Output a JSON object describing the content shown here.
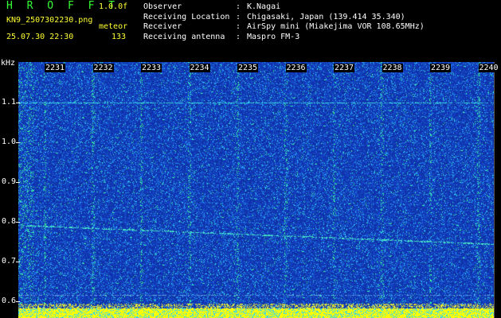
{
  "header": {
    "title": "H R O F F T",
    "version": "1.0.0f",
    "filename": "KN9_2507302230.png",
    "meteor_label": "meteor",
    "datetime": "25.07.30 22:30",
    "count": "133"
  },
  "info": [
    {
      "key": "Observer",
      "value": "K.Nagai"
    },
    {
      "key": "Receiving Location",
      "value": "Chigasaki, Japan (139.414 35.340)"
    },
    {
      "key": "Receiver",
      "value": "AirSpy mini (Miakejima VOR 108.65MHz)"
    },
    {
      "key": "Receiving antenna",
      "value": "Maspro FM-3"
    }
  ],
  "axes": {
    "y_unit": "kHz",
    "y_ticks": [
      "1.1",
      "1.0",
      "0.9",
      "0.8",
      "0.7",
      "0.6"
    ],
    "x_ticks": [
      "2231",
      "2232",
      "2233",
      "2234",
      "2235",
      "2236",
      "2237",
      "2238",
      "2239",
      "2240"
    ]
  },
  "colors": {
    "background": "#000000",
    "spectrum_base": "#1838b8",
    "noise_cyan": "#33ccff",
    "noise_green": "#33ff99",
    "bottom_band": "#ffff00"
  }
}
